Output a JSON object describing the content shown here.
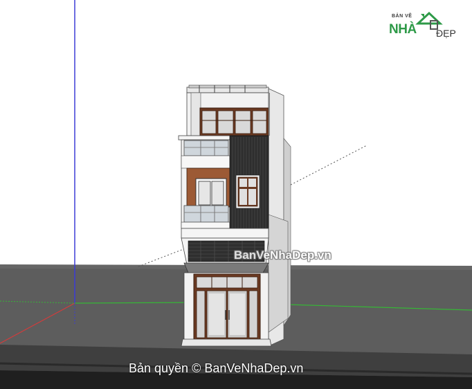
{
  "viewport": {
    "sky_color": "#ffffff",
    "ground_color": "#5a5a5a"
  },
  "axes": {
    "blue_axis_color": "#3b3bd6",
    "red_axis_color": "#d83a3a",
    "green_axis_color": "#36b736"
  },
  "model": {
    "name": "3-storey townhouse model"
  },
  "logo": {
    "small_text": "BẢN VẼ",
    "brand_text": "NHÀ",
    "suffix_text": "ĐẸP",
    "brand_color": "#2e9a48",
    "icon": "house-icon"
  },
  "watermarks": {
    "center": "BanVeNhaDep.vn",
    "bottom": "Bản quyền © BanVeNhaDep.vn"
  }
}
